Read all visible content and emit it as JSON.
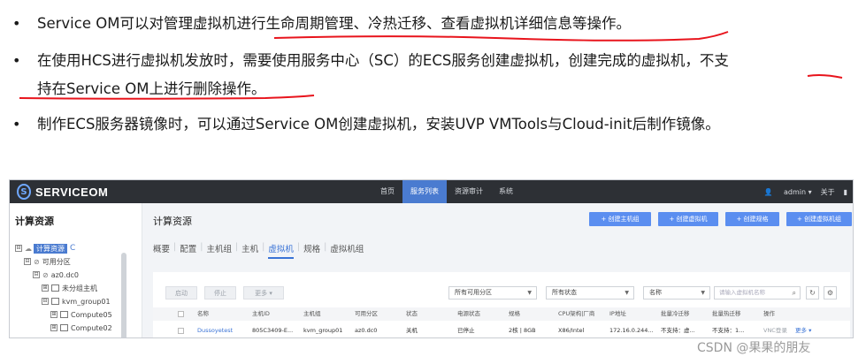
{
  "bullets": [
    {
      "dot": "•",
      "text": "Service OM可以对管理虚拟机进行生命周期管理、冷热迁移、查看虚拟机详细信息等操作。"
    },
    {
      "dot": "•",
      "line1": "在使用HCS进行虚拟机发放时，需要使用服务中心（SC）的ECS服务创建虚拟机，创建完成的虚拟机，不支",
      "line2": "持在Service OM上进行删除操作。"
    },
    {
      "dot": "•",
      "text": "制作ECS服务器镜像时，可以通过Service OM创建虚拟机，安装UVP VMTools与Cloud-init后制作镜像。"
    }
  ],
  "annotation_color": "#e8141c",
  "app": {
    "logo_text": "SERVICEOM",
    "logo_mark": "S",
    "nav": [
      "首页",
      "服务列表",
      "资源审计",
      "系统"
    ],
    "nav_active": "服务列表",
    "user": "admin ▾",
    "about": "关于",
    "top_right_extra": "▮",
    "accent": "#4a7bd0"
  },
  "sidebar": {
    "title": "计算资源",
    "tree": [
      {
        "expander": "⊟",
        "label": "计算资源",
        "highlighted": true,
        "refresh_icon": "C"
      },
      {
        "expander": "⊟",
        "label": "可用分区"
      },
      {
        "expander": "⊟",
        "label": "az0.dc0"
      },
      {
        "expander": "⊞",
        "label": "未分组主机"
      },
      {
        "expander": "⊟",
        "label": "kvm_group01"
      },
      {
        "expander": "⊞",
        "label": "Compute05"
      },
      {
        "expander": "⊞",
        "label": "Compute02"
      }
    ]
  },
  "main": {
    "title": "计算资源",
    "actions": [
      "+ 创建主机组",
      "+ 创建虚拟机",
      "+ 创建规格",
      "+ 创建虚拟机组"
    ],
    "tabs": [
      "概要",
      "配置",
      "主机组",
      "主机",
      "虚拟机",
      "规格",
      "虚拟机组"
    ],
    "tab_active": "虚拟机",
    "toolbar": {
      "start": "启动",
      "stop": "停止",
      "more": "更多 ▾",
      "zone_filter": "所有可用分区",
      "status_filter": "所有状态",
      "field_filter": "名称",
      "search_placeholder": "请输入虚拟机名称",
      "search_icon": "⌕",
      "refresh_icon": "↻",
      "settings_icon": "⚙"
    },
    "table": {
      "headers": [
        "名称",
        "主机ID",
        "主机组",
        "可用分区",
        "状态",
        "电源状态",
        "规格",
        "CPU架构|厂商",
        "IP地址",
        "批量冷迁移",
        "批量热迁移",
        "操作"
      ],
      "rows": [
        [
          "Dussoyetest",
          "805C3409-E...",
          "kvm_group01",
          "az0.dc0",
          "关机",
          "已停止",
          "2核 | 8GB",
          "X86/Intel",
          "172.16.0.244...",
          "不支持：虚...",
          "不支持：1...",
          "VNC登录",
          "更多 ▾"
        ]
      ]
    }
  },
  "watermark": "CSDN @果果的朋友"
}
